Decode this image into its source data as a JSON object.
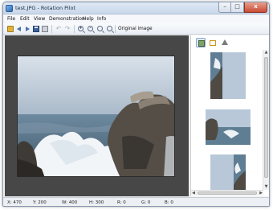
{
  "window": {
    "title": "test.JPG - Rotation Pilot",
    "controls": {
      "minimize": "–",
      "maximize": "□",
      "close": "x"
    }
  },
  "menubar": {
    "items": [
      "File",
      "Edit",
      "View",
      "Demonstration",
      "Help",
      "Info"
    ]
  },
  "toolbar": {
    "icons": [
      "open-folder-icon",
      "back-arrow-icon",
      "forward-arrow-icon",
      "save-icon",
      "print-icon",
      "undo-icon",
      "redo-icon",
      "zoom-in-icon",
      "zoom-out-icon",
      "zoom-fit-icon",
      "zoom-actual-icon"
    ],
    "original_image_label": "Original image"
  },
  "sidebar": {
    "mode_icons": [
      "image-mode-icon",
      "frame-mode-icon",
      "triangle-mode-icon"
    ],
    "thumbnails": [
      "thumbnail-rotated-left",
      "thumbnail-sideways",
      "thumbnail-rotated-right"
    ]
  },
  "statusbar": {
    "x": "X: 470",
    "y": "Y: 200",
    "w": "W: 400",
    "h": "H: 300",
    "r": "R: 0",
    "g": "G: 0",
    "b": "B: 0"
  },
  "colors": {
    "canvas_bg": "#474747",
    "sky": "#b8c8d8",
    "sea": "#5f7d93",
    "rock": "#4f4a43"
  }
}
